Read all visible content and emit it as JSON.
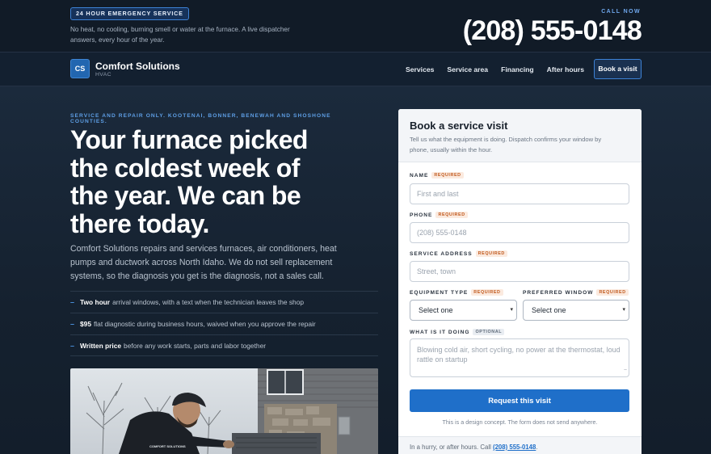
{
  "topbar": {
    "badge": "24 HOUR EMERGENCY SERVICE",
    "text": "No heat, no cooling, burning smell or water at the furnace. A live dispatcher answers, every hour of the year.",
    "call_now": "CALL NOW",
    "phone": "(208) 555-0148"
  },
  "nav": {
    "logo_initials": "CS",
    "brand_name": "Comfort Solutions",
    "brand_sub": "HVAC",
    "links": [
      "Services",
      "Service area",
      "Financing",
      "After hours"
    ],
    "cta": "Book a visit"
  },
  "hero": {
    "eyebrow": "SERVICE AND REPAIR ONLY. KOOTENAI, BONNER, BENEWAH AND SHOSHONE COUNTIES.",
    "headline": "Your furnace picked the coldest week of the year. We can be there today.",
    "lede": "Comfort Solutions repairs and services furnaces, air conditioners, heat pumps and ductwork across North Idaho. We do not sell replacement systems, so the diagnosis you get is the diagnosis, not a sales call.",
    "bullets": [
      {
        "bold": "Two hour",
        "text": "arrival windows, with a text when the technician leaves the shop"
      },
      {
        "bold": "$95",
        "text": "flat diagnostic during business hours, waived when you approve the repair"
      },
      {
        "bold": "Written price",
        "text": "before any work starts, parts and labor together"
      }
    ]
  },
  "form": {
    "title": "Book a service visit",
    "description": "Tell us what the equipment is doing. Dispatch confirms your window by phone, usually within the hour.",
    "name_label": "NAME",
    "name_placeholder": "First and last",
    "phone_label": "PHONE",
    "phone_placeholder": "(208) 555-0148",
    "address_label": "SERVICE ADDRESS",
    "address_placeholder": "Street, town",
    "equipment_label": "EQUIPMENT TYPE",
    "equipment_value": "Select one",
    "window_label": "PREFERRED WINDOW",
    "window_value": "Select one",
    "doing_label": "WHAT IS IT DOING",
    "doing_placeholder": "Blowing cold air, short cycling, no power at the thermostat, loud rattle on startup",
    "required_tag": "REQUIRED",
    "optional_tag": "OPTIONAL",
    "submit": "Request this visit",
    "note": "This is a design concept. The form does not send anywhere.",
    "footer_text": "In a hurry, or after hours. Call",
    "footer_phone": "(208) 555-0148",
    "footer_end": "."
  },
  "photo": {
    "van_text": "COMFORT SOLUTIONS"
  },
  "colors": {
    "accent": "#1f6fc9",
    "background": "#14202e",
    "required": "#c15a1e"
  }
}
